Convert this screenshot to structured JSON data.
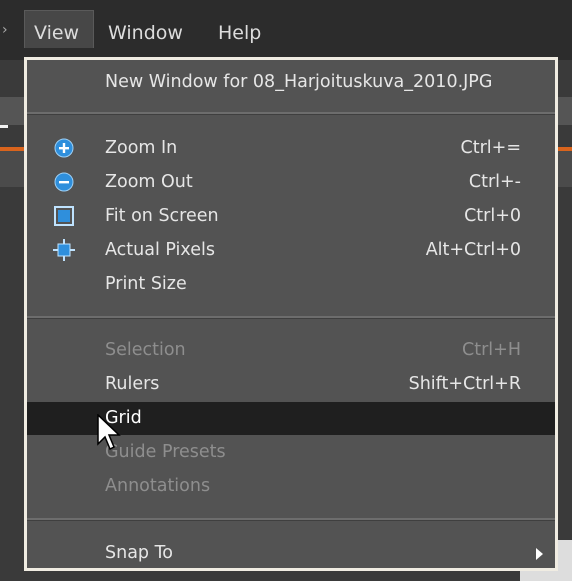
{
  "menubar": {
    "items": [
      "View",
      "Window",
      "Help"
    ]
  },
  "menu": {
    "new_window": "New Window for 08_Harjoituskuva_2010.JPG",
    "items": [
      {
        "label": "Zoom In",
        "shortcut": "Ctrl+=",
        "icon": "zoom-in-icon"
      },
      {
        "label": "Zoom Out",
        "shortcut": "Ctrl+-",
        "icon": "zoom-out-icon"
      },
      {
        "label": "Fit on Screen",
        "shortcut": "Ctrl+0",
        "icon": "fit-screen-icon"
      },
      {
        "label": "Actual Pixels",
        "shortcut": "Alt+Ctrl+0",
        "icon": "actual-pixels-icon"
      },
      {
        "label": "Print Size",
        "shortcut": ""
      }
    ],
    "selection": {
      "label": "Selection",
      "shortcut": "Ctrl+H"
    },
    "rulers": {
      "label": "Rulers",
      "shortcut": "Shift+Ctrl+R"
    },
    "grid": {
      "label": "Grid"
    },
    "guide_presets": {
      "label": "Guide Presets"
    },
    "annotations": {
      "label": "Annotations"
    },
    "snap_to": {
      "label": "Snap To"
    }
  },
  "colors": {
    "menu_bg": "#535353",
    "highlight": "#1f1f1f",
    "accent_orange": "#d9641d",
    "icon_blue": "#2f8fdc"
  }
}
